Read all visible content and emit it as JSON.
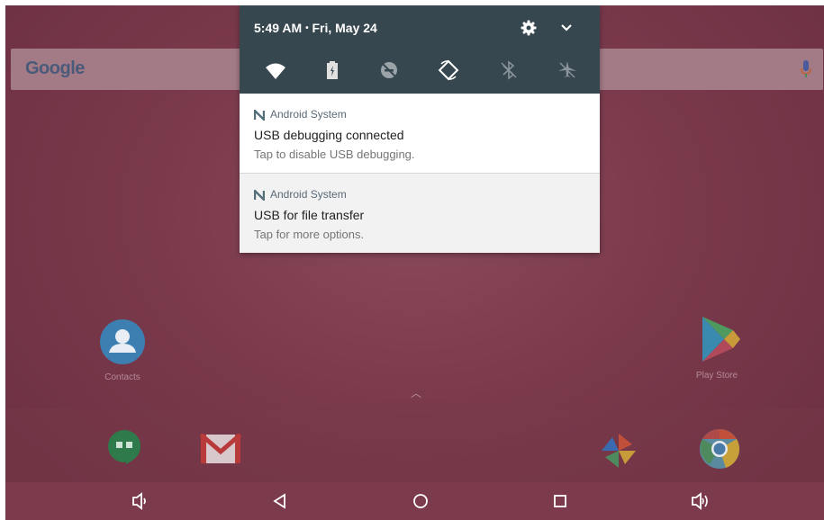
{
  "status": {
    "time": "5:49 AM",
    "separator": "•",
    "date": "Fri, May 24"
  },
  "search": {
    "logo_text": "Google"
  },
  "quick_settings": {
    "tiles": [
      "wifi-icon",
      "battery-saver-icon",
      "do-not-disturb-off-icon",
      "auto-rotate-icon",
      "bluetooth-off-icon",
      "airplane-mode-off-icon"
    ]
  },
  "notifications": [
    {
      "app": "Android System",
      "title": "USB debugging connected",
      "text": "Tap to disable USB debugging."
    },
    {
      "app": "Android System",
      "title": "USB for file transfer",
      "text": "Tap for more options."
    }
  ],
  "desktop": {
    "contacts_label": "Contacts",
    "playstore_label": "Play Store"
  },
  "dock": {
    "apps": [
      "hangouts-icon",
      "gmail-icon",
      "photos-icon",
      "chrome-icon"
    ]
  },
  "navbar": {
    "buttons": [
      "volume-down-icon",
      "back-icon",
      "home-icon",
      "recents-icon",
      "volume-up-icon"
    ]
  },
  "colors": {
    "wallpaper": "#7a3a4c",
    "shade_header": "#37474f",
    "notification_bg": "#ffffff",
    "notification_bg_alt": "#f2f2f2"
  }
}
